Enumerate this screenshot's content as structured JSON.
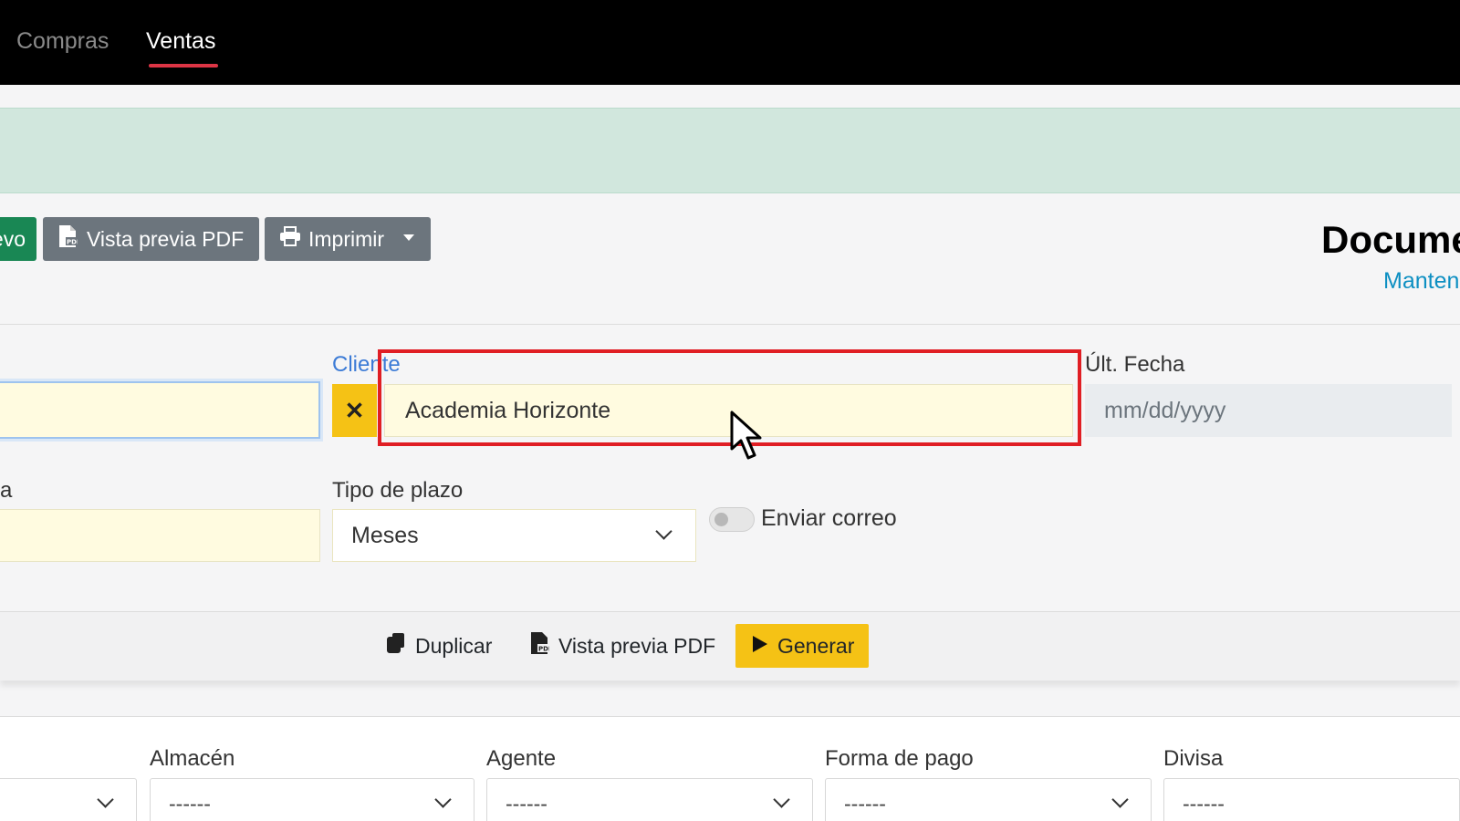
{
  "nav": {
    "items": [
      {
        "label": "Compras",
        "active": false
      },
      {
        "label": "Ventas",
        "active": true
      }
    ]
  },
  "toolbar": {
    "new_label": "evo",
    "pdf_label": "Vista previa PDF",
    "print_label": "Imprimir"
  },
  "document": {
    "title": "Docume",
    "subtitle": "Manten"
  },
  "form": {
    "cliente_label": "Cliente",
    "cliente_value": "Academia Horizonte",
    "ult_fecha_label": "Últ. Fecha",
    "ult_fecha_placeholder": "mm/dd/yyyy",
    "partial_label": "a",
    "tipo_plazo_label": "Tipo de plazo",
    "tipo_plazo_value": "Meses",
    "enviar_correo_label": "Enviar correo",
    "enviar_correo_on": false
  },
  "actions": {
    "duplicar_label": "Duplicar",
    "pdf_label": "Vista previa PDF",
    "generar_label": "Generar"
  },
  "lower": {
    "almacen_label": "Almacén",
    "agente_label": "Agente",
    "forma_pago_label": "Forma de pago",
    "divisa_label": "Divisa",
    "placeholder": "------"
  },
  "colors": {
    "accent_green": "#198754",
    "accent_yellow": "#f5c215",
    "nav_underline": "#dc3545",
    "highlight_box": "#e01e24"
  }
}
